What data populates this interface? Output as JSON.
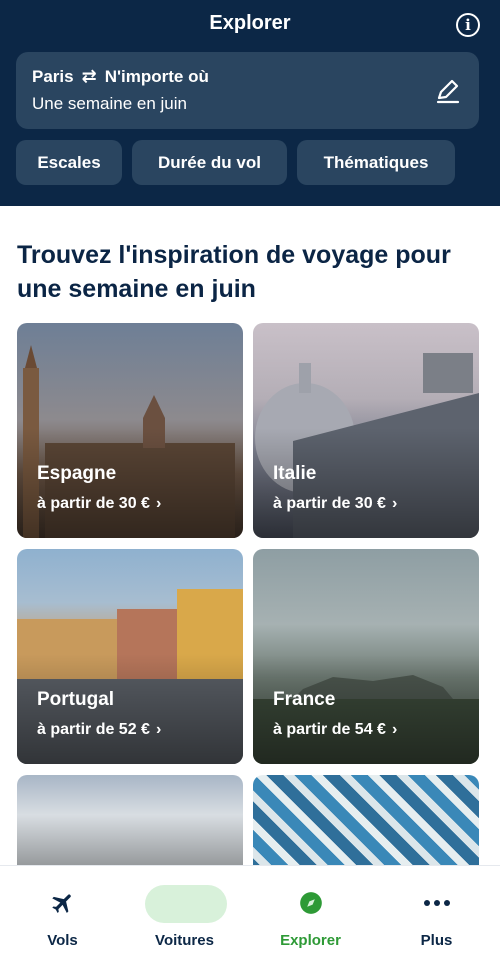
{
  "header": {
    "title": "Explorer",
    "info_icon": "info-icon",
    "search": {
      "origin": "Paris",
      "swap_icon": "swap-arrows-icon",
      "destination": "N'importe où",
      "dates": "Une semaine en juin",
      "edit_icon": "pencil-icon"
    },
    "filters": [
      "Escales",
      "Durée du vol",
      "Thématiques"
    ]
  },
  "main": {
    "headline": "Trouvez l'inspiration de voyage pour une semaine en juin",
    "destinations": [
      {
        "name": "Espagne",
        "price": "à partir de 30 €"
      },
      {
        "name": "Italie",
        "price": "à partir de 30 €"
      },
      {
        "name": "Portugal",
        "price": "à partir de 52 €"
      },
      {
        "name": "France",
        "price": "à partir de 54 €"
      }
    ],
    "chevron": "›"
  },
  "bottom_nav": {
    "items": [
      {
        "label": "Vols",
        "icon": "plane-icon"
      },
      {
        "label": "Voitures",
        "icon": "car-icon"
      },
      {
        "label": "Explorer",
        "icon": "compass-icon",
        "active": true
      },
      {
        "label": "Plus",
        "icon": "more-dots-icon"
      }
    ],
    "active_color": "#2e9a36"
  },
  "colors": {
    "header_bg": "#0c2746",
    "chip_bg": "#2a4560",
    "text_dark": "#0b2545"
  }
}
